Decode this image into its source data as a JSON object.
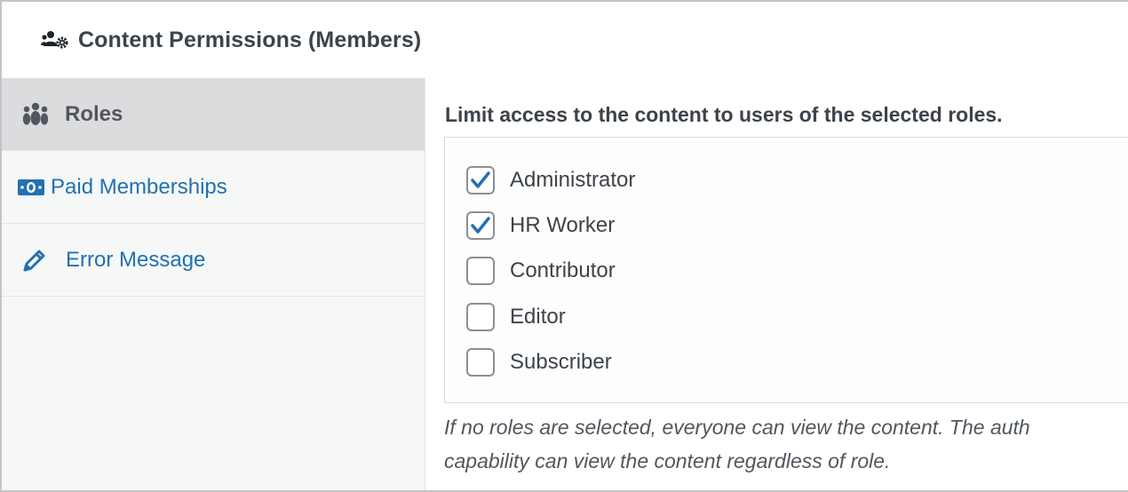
{
  "header": {
    "title": "Content Permissions (Members)",
    "icon": "users-gear-icon"
  },
  "tabs": [
    {
      "label": "Roles",
      "icon": "group-icon",
      "active": true
    },
    {
      "label": "Paid Memberships",
      "icon": "money-icon",
      "active": false
    },
    {
      "label": "Error Message",
      "icon": "pencil-icon",
      "active": false
    }
  ],
  "roles_section": {
    "title": "Limit access to the content to users of the selected roles.",
    "roles": [
      {
        "label": "Administrator",
        "checked": true
      },
      {
        "label": "HR Worker",
        "checked": true
      },
      {
        "label": "Contributor",
        "checked": false
      },
      {
        "label": "Editor",
        "checked": false
      },
      {
        "label": "Subscriber",
        "checked": false
      }
    ],
    "help_line1": "If no roles are selected, everyone can view the content. The auth",
    "help_line2": "capability can view the content regardless of role."
  },
  "colors": {
    "link": "#2271b1",
    "check": "#2271b1",
    "text": "#3c434a",
    "active_tab_bg": "#dcdcde"
  }
}
